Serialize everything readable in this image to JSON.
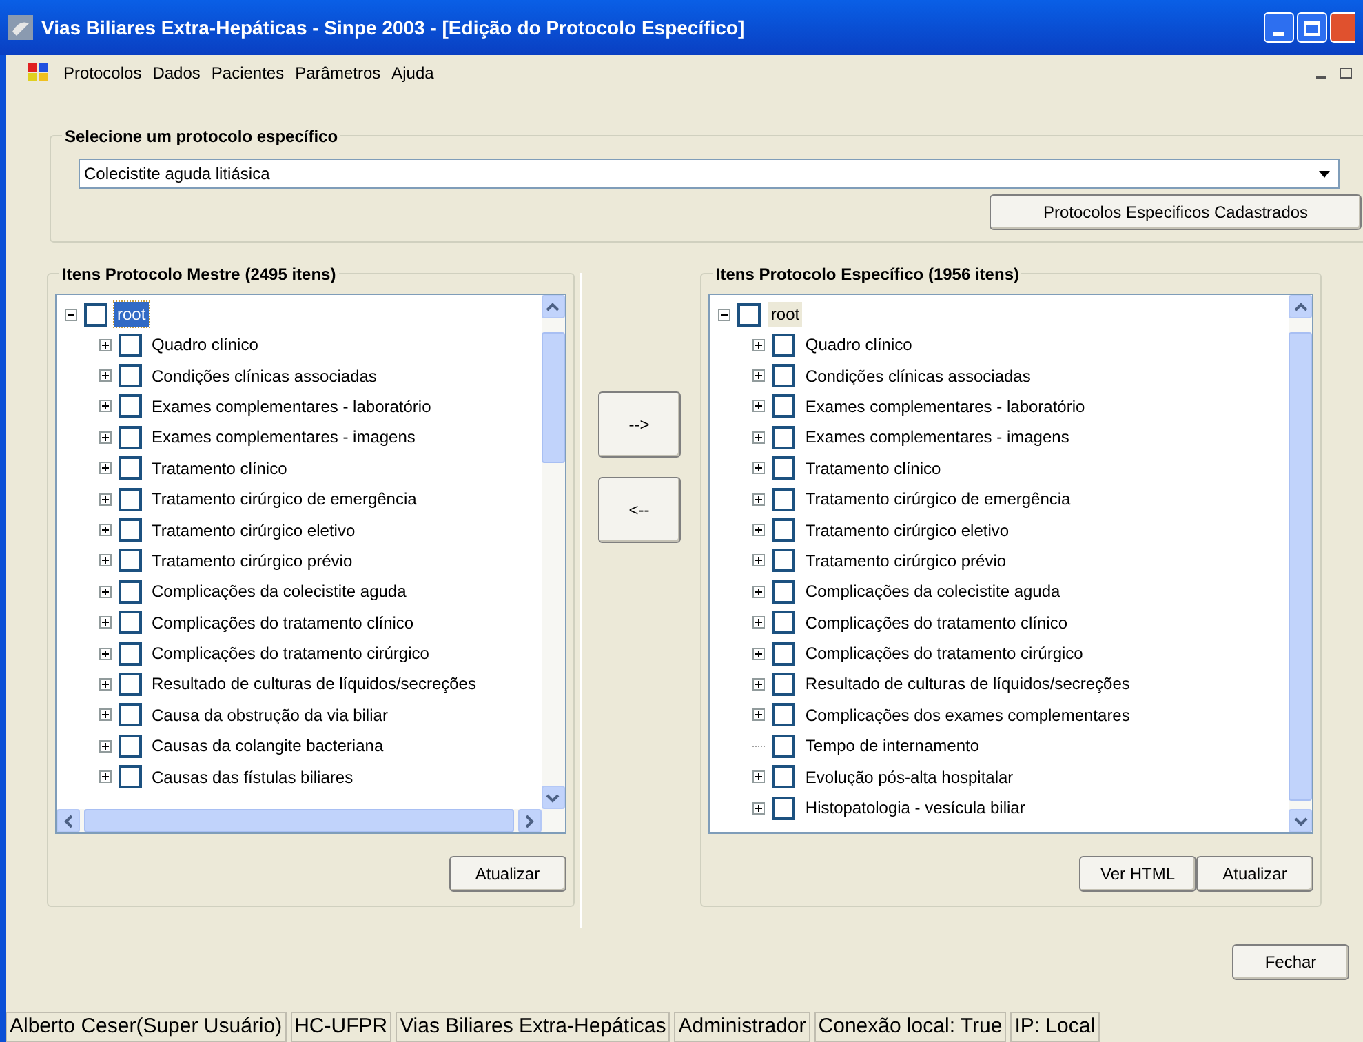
{
  "window": {
    "title": "Vias Biliares Extra-Hepáticas - Sinpe 2003 - [Edição do Protocolo Específico]"
  },
  "menu": [
    "Protocolos",
    "Dados",
    "Pacientes",
    "Parâmetros",
    "Ajuda"
  ],
  "selector": {
    "label": "Selecione um protocolo específico",
    "value": "Colecistite aguda litiásica",
    "button": "Protocolos Especificos Cadastrados"
  },
  "master": {
    "title": "Itens Protocolo Mestre (2495 itens)",
    "buttons": [
      "Atualizar"
    ],
    "tree": {
      "label": "root",
      "checked": false,
      "selected": true,
      "expanded": true,
      "children": [
        {
          "label": "Quadro clínico",
          "checked": false,
          "expandable": true
        },
        {
          "label": "Condições clínicas associadas",
          "checked": false,
          "expandable": true
        },
        {
          "label": "Exames complementares - laboratório",
          "checked": false,
          "expandable": true
        },
        {
          "label": "Exames complementares - imagens",
          "checked": false,
          "expandable": true
        },
        {
          "label": "Tratamento clínico",
          "checked": false,
          "expandable": true
        },
        {
          "label": "Tratamento cirúrgico de emergência",
          "checked": false,
          "expandable": true
        },
        {
          "label": "Tratamento cirúrgico eletivo",
          "checked": false,
          "expandable": true
        },
        {
          "label": "Tratamento cirúrgico prévio",
          "checked": false,
          "expandable": true
        },
        {
          "label": "Complicações da colecistite aguda",
          "checked": false,
          "expandable": true
        },
        {
          "label": "Complicações do tratamento clínico",
          "checked": false,
          "expandable": true
        },
        {
          "label": "Complicações do tratamento cirúrgico",
          "checked": false,
          "expandable": true
        },
        {
          "label": "Resultado de culturas de líquidos/secreções",
          "checked": false,
          "expandable": true
        },
        {
          "label": "Causa da obstrução da via biliar",
          "checked": false,
          "expandable": true
        },
        {
          "label": "Causas da colangite bacteriana",
          "checked": false,
          "expandable": true
        },
        {
          "label": "Causas das fístulas biliares",
          "checked": false,
          "expandable": true
        }
      ]
    }
  },
  "transfer_buttons": [
    "-->",
    "<--"
  ],
  "specific": {
    "title": "Itens Protocolo Específico (1956 itens)",
    "buttons": [
      "Ver HTML",
      "Atualizar"
    ],
    "tree": {
      "label": "root",
      "checked": false,
      "selected": false,
      "expanded": true,
      "children": [
        {
          "label": "Quadro clínico",
          "checked": false,
          "expandable": true
        },
        {
          "label": "Condições clínicas associadas",
          "checked": false,
          "expandable": true
        },
        {
          "label": "Exames complementares - laboratório",
          "checked": false,
          "expandable": true
        },
        {
          "label": "Exames complementares - imagens",
          "checked": false,
          "expandable": true
        },
        {
          "label": "Tratamento clínico",
          "checked": false,
          "expandable": true
        },
        {
          "label": "Tratamento cirúrgico de emergência",
          "checked": false,
          "expandable": true
        },
        {
          "label": "Tratamento cirúrgico eletivo",
          "checked": false,
          "expandable": true
        },
        {
          "label": "Tratamento cirúrgico prévio",
          "checked": false,
          "expandable": true
        },
        {
          "label": "Complicações da colecistite aguda",
          "checked": false,
          "expandable": true
        },
        {
          "label": "Complicações do tratamento clínico",
          "checked": false,
          "expandable": true
        },
        {
          "label": "Complicações do tratamento cirúrgico",
          "checked": false,
          "expandable": true
        },
        {
          "label": "Resultado de culturas de líquidos/secreções",
          "checked": false,
          "expandable": true
        },
        {
          "label": "Complicações dos exames complementares",
          "checked": false,
          "expandable": true
        },
        {
          "label": "Tempo de internamento",
          "checked": false,
          "expandable": false
        },
        {
          "label": "Evolução pós-alta hospitalar",
          "checked": false,
          "expandable": true
        },
        {
          "label": "Histopatologia - vesícula biliar",
          "checked": false,
          "expandable": true
        }
      ]
    }
  },
  "close_button": "Fechar",
  "status_bar": [
    "Alberto Ceser(Super Usuário)",
    "HC-UFPR",
    "Vias Biliares Extra-Hepáticas",
    "Administrador",
    "Conexão local: True",
    "IP: Local"
  ]
}
